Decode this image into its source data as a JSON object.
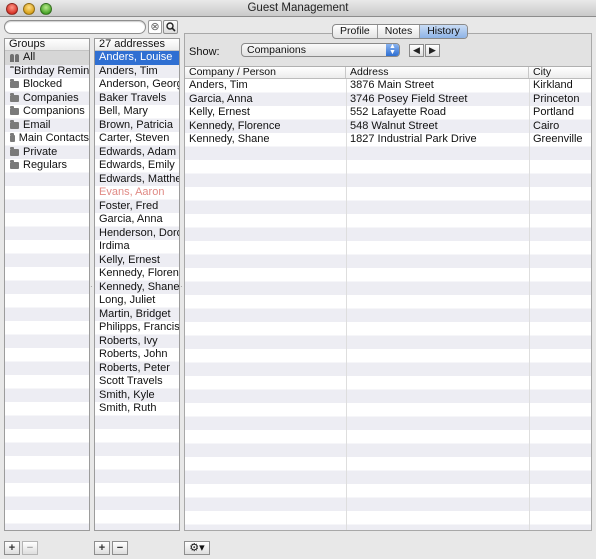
{
  "window": {
    "title": "Guest Management"
  },
  "search": {
    "value": "",
    "placeholder": ""
  },
  "groups": {
    "header": "Groups",
    "items": [
      "All",
      "Birthday Reminder",
      "Blocked",
      "Companies",
      "Companions",
      "Email",
      "Main Contacts",
      "Private",
      "Regulars"
    ]
  },
  "addresses": {
    "header": "27 addresses",
    "items": [
      "Anders, Louise",
      "Anders, Tim",
      "Anderson, George",
      "Baker Travels",
      "Bell, Mary",
      "Brown, Patricia",
      "Carter, Steven",
      "Edwards, Adam",
      "Edwards, Emily",
      "Edwards, Matthew",
      "Evans, Aaron",
      "Foster, Fred",
      "Garcia, Anna",
      "Henderson, Dorothy",
      "Irdima",
      "Kelly, Ernest",
      "Kennedy, Florence",
      "Kennedy, Shane",
      "Long, Juliet",
      "Martin, Bridget",
      "Philipps, Francis",
      "Roberts, Ivy",
      "Roberts, John",
      "Roberts, Peter",
      "Scott Travels",
      "Smith, Kyle",
      "Smith, Ruth"
    ]
  },
  "tabs": [
    "Profile",
    "Notes",
    "History"
  ],
  "show": {
    "label": "Show:",
    "value": "Companions"
  },
  "table": {
    "columns": [
      "Company / Person",
      "Address",
      "City"
    ],
    "rows": [
      [
        "Anders, Tim",
        "3876 Main Street",
        "Kirkland"
      ],
      [
        "Garcia, Anna",
        "3746 Posey Field Street",
        "Princeton"
      ],
      [
        "Kelly, Ernest",
        "552 Lafayette Road",
        "Portland"
      ],
      [
        "Kennedy, Florence",
        "548 Walnut Street",
        "Cairo"
      ],
      [
        "Kennedy, Shane",
        "1827 Industrial Park Drive",
        "Greenville"
      ]
    ]
  },
  "buttons": {
    "add": "+",
    "remove": "−",
    "gear": "⚙▾",
    "clear": "⊗",
    "prev": "◀",
    "next": "▶",
    "search_glyph": "🔍"
  },
  "colors": {
    "selection": "#2f6fd2",
    "muted_row": "#e08a85"
  }
}
